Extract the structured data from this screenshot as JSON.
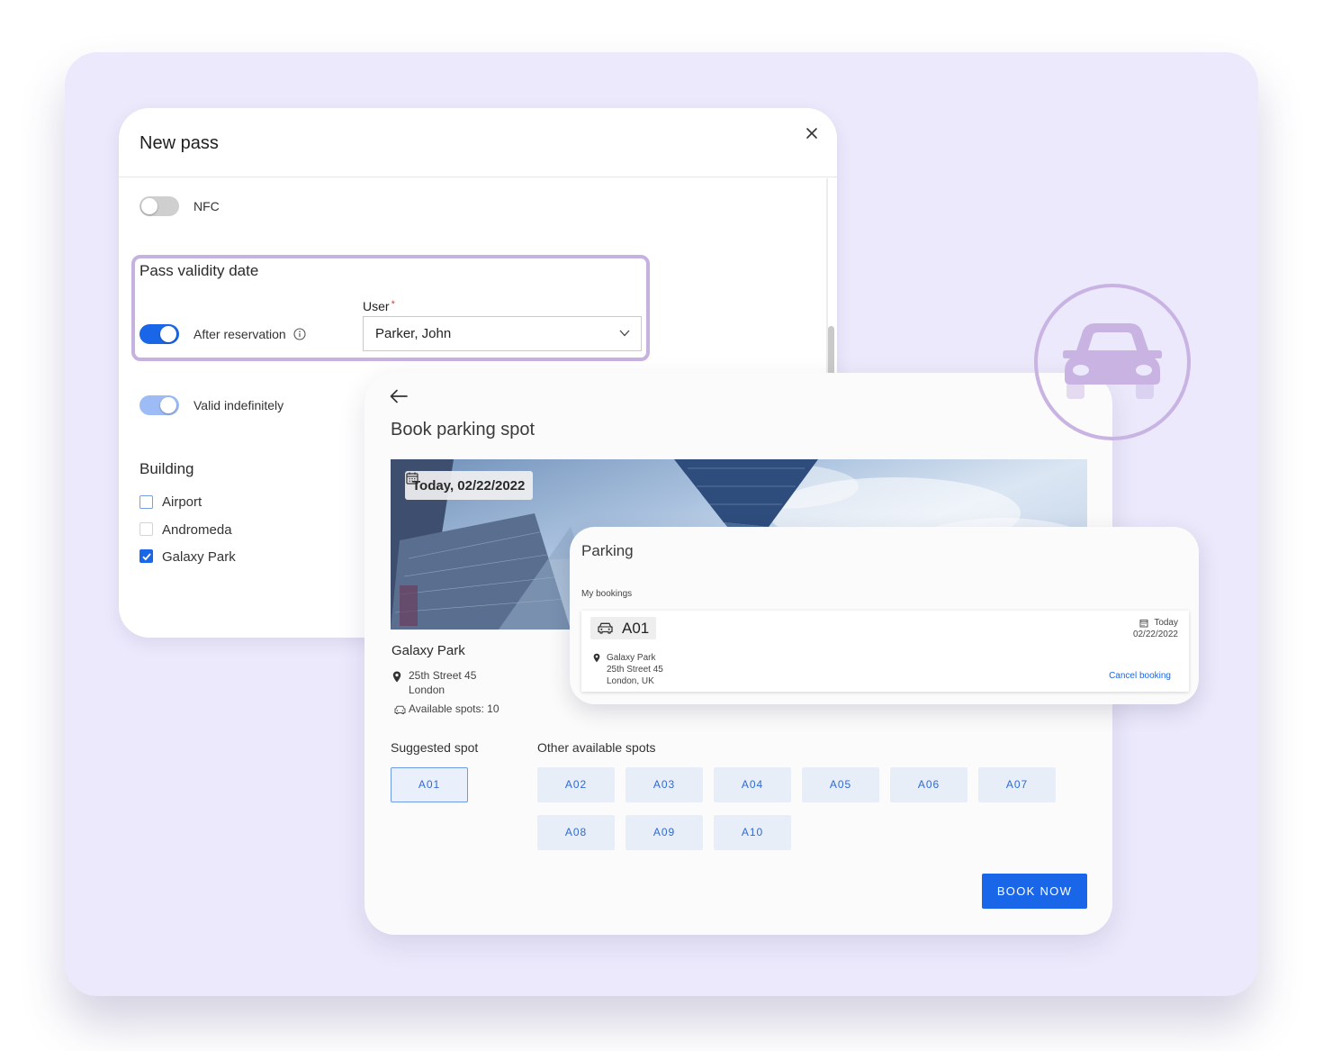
{
  "new_pass": {
    "title": "New pass",
    "close_icon": "close-icon",
    "nfc": {
      "label": "NFC",
      "enabled": false
    },
    "pass_validity": {
      "title": "Pass validity date",
      "after_reservation": {
        "label": "After reservation",
        "enabled": true
      },
      "user": {
        "label": "User",
        "required_mark": "*",
        "value": "Parker, John"
      }
    },
    "valid_indefinitely": {
      "label": "Valid indefinitely",
      "enabled": true
    },
    "building": {
      "title": "Building",
      "options": [
        {
          "label": "Airport",
          "checked": false
        },
        {
          "label": "Andromeda",
          "checked": false
        },
        {
          "label": "Galaxy Park",
          "checked": true
        }
      ]
    }
  },
  "book_parking": {
    "title": "Book parking spot",
    "date": "Today, 02/22/2022",
    "location": {
      "name": "Galaxy Park",
      "address_line1": "25th Street 45",
      "address_line2": "London",
      "available": "Available spots: 10"
    },
    "suggested_label": "Suggested spot",
    "suggested_spot": "A01",
    "other_label": "Other available spots",
    "other_spots": [
      "A02",
      "A03",
      "A04",
      "A05",
      "A06",
      "A07",
      "A08",
      "A09",
      "A10"
    ],
    "book_button": "BOOK NOW"
  },
  "parking_card": {
    "title": "Parking",
    "subtitle": "My bookings",
    "booking": {
      "spot": "A01",
      "date_label": "Today",
      "date": "02/22/2022",
      "place_name": "Galaxy Park",
      "address_line1": "25th Street 45",
      "address_line2": "London, UK",
      "cancel": "Cancel booking"
    }
  },
  "colors": {
    "accent": "#1a66e8",
    "backdrop": "#ece9fc",
    "highlight_border": "#c6b2e0",
    "car_icon": "#c8b3e2"
  }
}
